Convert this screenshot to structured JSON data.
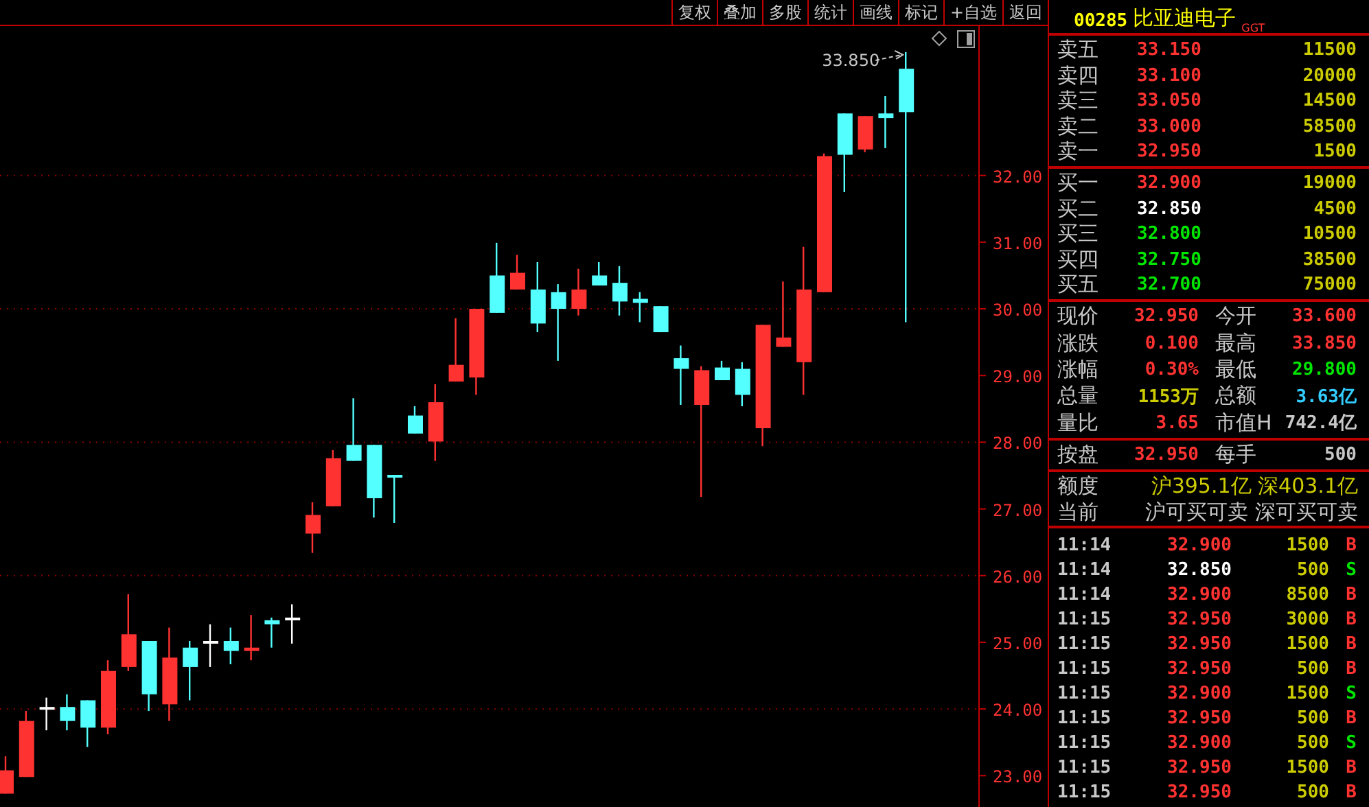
{
  "toolbar": {
    "buttons": [
      "复权",
      "叠加",
      "多股",
      "统计",
      "画线",
      "标记",
      "+自选",
      "返回"
    ]
  },
  "chart": {
    "chart_data": {
      "type": "candlestick",
      "grid": true,
      "ylim": [
        22.53,
        34.24
      ],
      "yticks": [
        {
          "value": 23,
          "label": "23.00"
        },
        {
          "value": 24,
          "label": "24.00"
        },
        {
          "value": 25,
          "label": "25.00"
        },
        {
          "value": 26,
          "label": "26.00"
        },
        {
          "value": 27,
          "label": "27.00"
        },
        {
          "value": 28,
          "label": "28.00"
        },
        {
          "value": 29,
          "label": "29.00"
        },
        {
          "value": 30,
          "label": "30.00"
        },
        {
          "value": 31,
          "label": "31.00"
        },
        {
          "value": 32,
          "label": "32.00"
        }
      ],
      "ohlc": [
        [
          22.73,
          23.29,
          22.73,
          23.08
        ],
        [
          22.98,
          23.97,
          22.98,
          23.82
        ],
        [
          24.03,
          24.17,
          23.68,
          24.03
        ],
        [
          24.03,
          24.22,
          23.68,
          23.82
        ],
        [
          24.13,
          24.13,
          23.43,
          23.72
        ],
        [
          23.72,
          24.73,
          23.62,
          24.57
        ],
        [
          24.63,
          25.72,
          24.57,
          25.12
        ],
        [
          25.02,
          25.02,
          23.97,
          24.22
        ],
        [
          24.07,
          25.22,
          23.82,
          24.77
        ],
        [
          24.92,
          25.02,
          24.13,
          24.63
        ],
        [
          25.02,
          25.27,
          24.63,
          25.02
        ],
        [
          25.02,
          25.22,
          24.67,
          24.87
        ],
        [
          24.87,
          25.41,
          24.73,
          24.92
        ],
        [
          25.33,
          25.37,
          24.92,
          25.27
        ],
        [
          25.37,
          25.57,
          24.98,
          25.37
        ],
        [
          26.63,
          27.1,
          26.34,
          26.91
        ],
        [
          27.04,
          27.88,
          27.04,
          27.76
        ],
        [
          27.96,
          28.66,
          27.72,
          27.72
        ],
        [
          27.96,
          27.96,
          26.87,
          27.16
        ],
        [
          27.51,
          27.51,
          26.79,
          27.49
        ],
        [
          28.4,
          28.54,
          28.13,
          28.13
        ],
        [
          28.01,
          28.87,
          27.72,
          28.6
        ],
        [
          28.91,
          29.86,
          28.91,
          29.16
        ],
        [
          28.97,
          30.0,
          28.71,
          30.0
        ],
        [
          30.5,
          30.99,
          29.94,
          29.94
        ],
        [
          30.29,
          30.81,
          30.29,
          30.54
        ],
        [
          30.29,
          30.7,
          29.65,
          29.78
        ],
        [
          30.25,
          30.37,
          29.22,
          30.0
        ],
        [
          30.0,
          30.6,
          29.9,
          30.29
        ],
        [
          30.5,
          30.7,
          30.35,
          30.35
        ],
        [
          30.39,
          30.64,
          29.9,
          30.11
        ],
        [
          30.15,
          30.25,
          29.8,
          30.09
        ],
        [
          30.04,
          30.04,
          29.65,
          29.65
        ],
        [
          29.26,
          29.45,
          28.56,
          29.1
        ],
        [
          28.56,
          29.14,
          27.18,
          29.08
        ],
        [
          29.12,
          29.22,
          28.93,
          28.93
        ],
        [
          29.1,
          29.2,
          28.54,
          28.71
        ],
        [
          28.21,
          29.76,
          27.94,
          29.76
        ],
        [
          29.43,
          30.41,
          29.43,
          29.57
        ],
        [
          29.2,
          30.93,
          28.71,
          30.29
        ],
        [
          30.25,
          32.33,
          30.25,
          32.29
        ],
        [
          32.93,
          32.93,
          31.75,
          32.31
        ],
        [
          32.39,
          32.89,
          32.35,
          32.89
        ],
        [
          32.93,
          33.19,
          32.41,
          32.86
        ],
        [
          33.6,
          33.85,
          29.8,
          32.95
        ]
      ],
      "annotations": [
        "33.850"
      ]
    }
  },
  "quote": {
    "code": "00285",
    "name": "比亚迪电子",
    "badge": "GGT"
  },
  "asks": [
    {
      "label": "卖五",
      "price": "33.150",
      "volume": "11500",
      "color": "#ff3232"
    },
    {
      "label": "卖四",
      "price": "33.100",
      "volume": "20000",
      "color": "#ff3232"
    },
    {
      "label": "卖三",
      "price": "33.050",
      "volume": "14500",
      "color": "#ff3232"
    },
    {
      "label": "卖二",
      "price": "33.000",
      "volume": "58500",
      "color": "#ff3232"
    },
    {
      "label": "卖一",
      "price": "32.950",
      "volume": "1500",
      "color": "#ff3232"
    }
  ],
  "bids": [
    {
      "label": "买一",
      "price": "32.900",
      "volume": "19000",
      "color": "#ff3232"
    },
    {
      "label": "买二",
      "price": "32.850",
      "volume": "4500",
      "color": "#ffffff"
    },
    {
      "label": "买三",
      "price": "32.800",
      "volume": "10500",
      "color": "#00e600"
    },
    {
      "label": "买四",
      "price": "32.750",
      "volume": "38500",
      "color": "#00e600"
    },
    {
      "label": "买五",
      "price": "32.700",
      "volume": "75000",
      "color": "#00e600"
    }
  ],
  "stats": [
    {
      "label": "现价",
      "value": "32.950",
      "color": "#ff3232"
    },
    {
      "label": "今开",
      "value": "33.600",
      "color": "#ff3232"
    },
    {
      "label": "涨跌",
      "value": "0.100",
      "color": "#ff3232"
    },
    {
      "label": "最高",
      "value": "33.850",
      "color": "#ff3232"
    },
    {
      "label": "涨幅",
      "value": "0.30%",
      "color": "#ff3232"
    },
    {
      "label": "最低",
      "value": "29.800",
      "color": "#00e600"
    },
    {
      "label": "总量",
      "value": "1153万",
      "color": "#cccc00"
    },
    {
      "label": "总额",
      "value": "3.63亿",
      "color": "#33ccff"
    },
    {
      "label": "量比",
      "value": "3.65",
      "color": "#ff3232"
    },
    {
      "label": "市值H",
      "value": "742.4亿",
      "color": "#c8c8c8"
    }
  ],
  "lot": [
    {
      "label": "按盘",
      "value": "32.950",
      "color": "#ff3232"
    },
    {
      "label": "每手",
      "value": "500",
      "color": "#c8c8c8"
    }
  ],
  "quota": {
    "label": "额度",
    "value": "沪395.1亿 深403.1亿"
  },
  "current": {
    "label": "当前",
    "value": "沪可买可卖 深可买可卖"
  },
  "trades": [
    {
      "time": "11:14",
      "price": "32.900",
      "volume": "1500",
      "side": "B",
      "kind": "buy",
      "color": "#ff3232"
    },
    {
      "time": "11:14",
      "price": "32.850",
      "volume": "500",
      "side": "S",
      "kind": "sell",
      "color": "#ffffff"
    },
    {
      "time": "11:14",
      "price": "32.900",
      "volume": "8500",
      "side": "B",
      "kind": "buy",
      "color": "#ff3232"
    },
    {
      "time": "11:15",
      "price": "32.950",
      "volume": "3000",
      "side": "B",
      "kind": "buy",
      "color": "#ff3232"
    },
    {
      "time": "11:15",
      "price": "32.950",
      "volume": "1500",
      "side": "B",
      "kind": "buy",
      "color": "#ff3232"
    },
    {
      "time": "11:15",
      "price": "32.950",
      "volume": "500",
      "side": "B",
      "kind": "buy",
      "color": "#ff3232"
    },
    {
      "time": "11:15",
      "price": "32.900",
      "volume": "1500",
      "side": "S",
      "kind": "sell",
      "color": "#ff3232"
    },
    {
      "time": "11:15",
      "price": "32.950",
      "volume": "500",
      "side": "B",
      "kind": "buy",
      "color": "#ff3232"
    },
    {
      "time": "11:15",
      "price": "32.900",
      "volume": "500",
      "side": "S",
      "kind": "sell",
      "color": "#ff3232"
    },
    {
      "time": "11:15",
      "price": "32.950",
      "volume": "1500",
      "side": "B",
      "kind": "buy",
      "color": "#ff3232"
    },
    {
      "time": "11:15",
      "price": "32.950",
      "volume": "500",
      "side": "B",
      "kind": "buy",
      "color": "#ff3232"
    }
  ]
}
